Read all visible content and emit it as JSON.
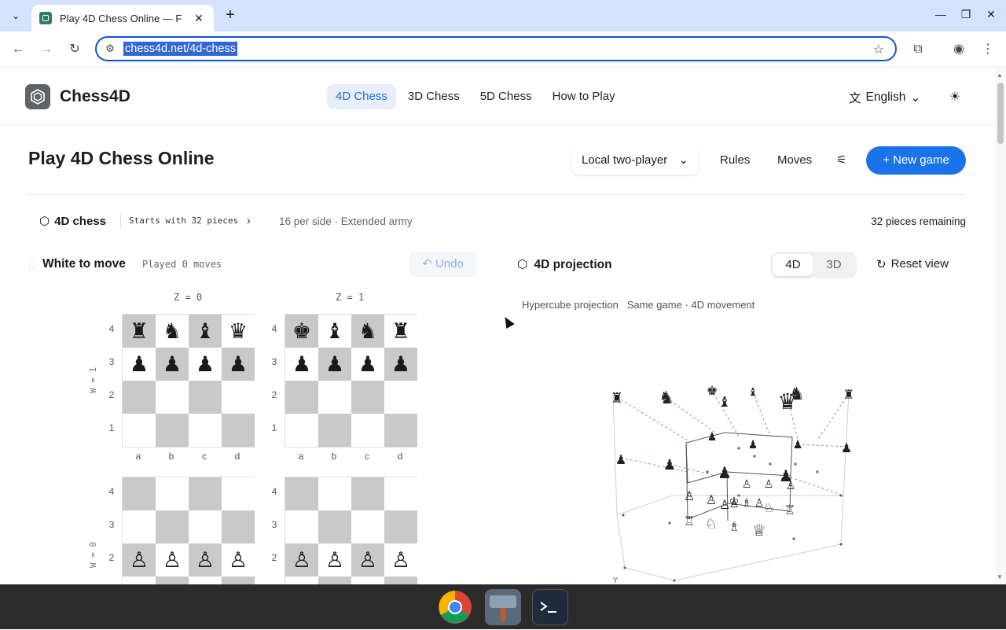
{
  "browser": {
    "tab_title": "Play 4D Chess Online — F",
    "url": "chess4d.net/4d-chess",
    "icons": [
      "tab-search-icon",
      "close-icon",
      "plus-icon",
      "back-icon",
      "forward-icon",
      "reload-icon",
      "site-info-icon",
      "star-icon",
      "extensions-icon",
      "profile-icon",
      "menu-icon"
    ]
  },
  "header": {
    "brand": "Chess4D",
    "nav": [
      "4D Chess",
      "3D Chess",
      "5D Chess",
      "How to Play"
    ],
    "active_nav": "4D Chess",
    "language": "English"
  },
  "page": {
    "title": "Play 4D Chess Online",
    "mode": "Local two-player",
    "rules": "Rules",
    "moves": "Moves",
    "new_game": "+ New game"
  },
  "info": {
    "variant": "4D chess",
    "starts": "Starts with 32 pieces",
    "per_side": "16 per side · Extended army",
    "remaining": "32 pieces remaining"
  },
  "game": {
    "turn": "White to move",
    "played": "Played 0 moves",
    "undo": "Undo",
    "z_labels": [
      "Z = 0",
      "Z = 1"
    ],
    "w_labels": [
      "W = 1",
      "W = 0"
    ],
    "ranks": [
      "4",
      "3",
      "2",
      "1"
    ],
    "files": [
      "a",
      "b",
      "c",
      "d"
    ],
    "boards": {
      "w1z0": [
        [
          "♜",
          "♞",
          "♝",
          "♛"
        ],
        [
          "♟",
          "♟",
          "♟",
          "♟"
        ],
        [
          "",
          "",
          "",
          ""
        ],
        [
          "",
          "",
          "",
          ""
        ]
      ],
      "w1z1": [
        [
          "♚",
          "♝",
          "♞",
          "♜"
        ],
        [
          "♟",
          "♟",
          "♟",
          "♟"
        ],
        [
          "",
          "",
          "",
          ""
        ],
        [
          "",
          "",
          "",
          ""
        ]
      ],
      "w0z0": [
        [
          "",
          "",
          "",
          ""
        ],
        [
          "",
          "",
          "",
          ""
        ],
        [
          "♙",
          "♙",
          "♙",
          "♙"
        ],
        [
          "♖",
          "♘",
          "♗",
          "♕"
        ]
      ],
      "w0z1": [
        [
          "",
          "",
          "",
          ""
        ],
        [
          "",
          "",
          "",
          ""
        ],
        [
          "♙",
          "♙",
          "♙",
          "♙"
        ],
        [
          "♔",
          "♗",
          "♘",
          "♖"
        ]
      ]
    }
  },
  "projection": {
    "title": "4D projection",
    "views": [
      "4D",
      "3D"
    ],
    "active_view": "4D",
    "reset": "Reset view",
    "subtitle_a": "Hypercube projection",
    "subtitle_b": "Same game · 4D movement",
    "axis_label": "Y"
  }
}
